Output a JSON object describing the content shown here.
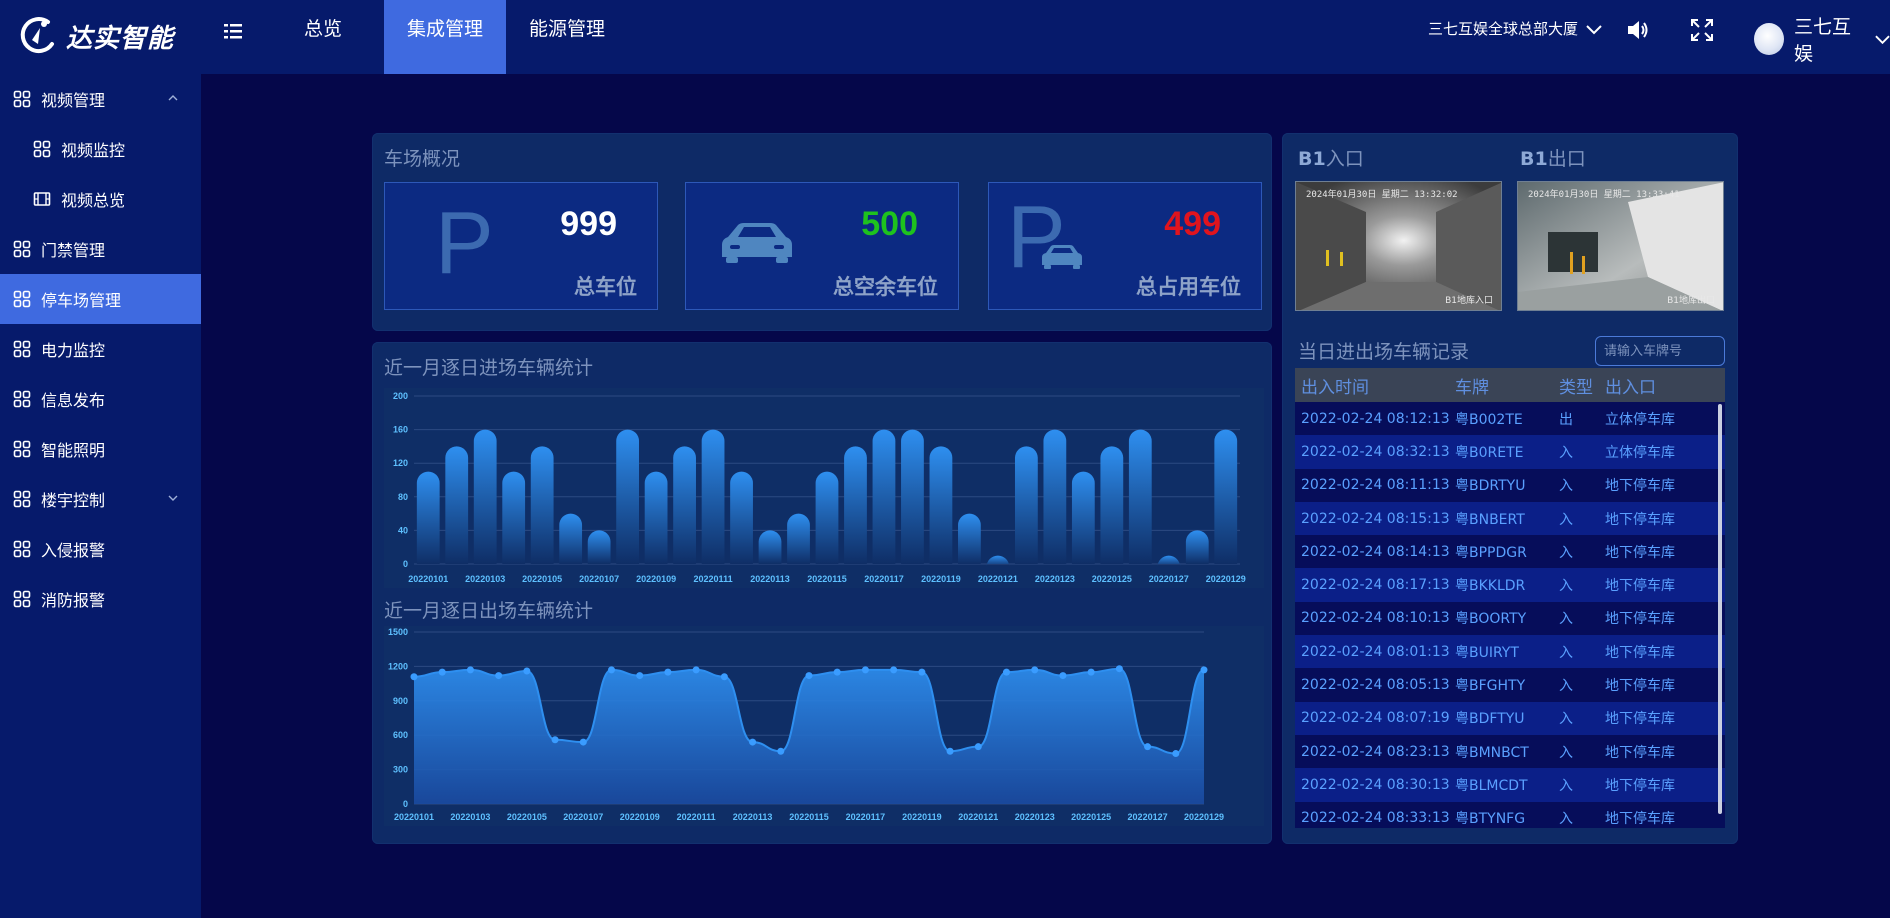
{
  "brand": {
    "name": "达实智能"
  },
  "nav": {
    "tabs": [
      {
        "label": "总览",
        "active": false
      },
      {
        "label": "集成管理",
        "active": true
      },
      {
        "label": "能源管理",
        "active": false
      }
    ],
    "location": "三七互娱全球总部大厦",
    "user": "三七互娱"
  },
  "sidebar": {
    "items": [
      {
        "label": "视频管理",
        "indent": false,
        "chevron": "up",
        "active": false
      },
      {
        "label": "视频监控",
        "indent": true,
        "chevron": "",
        "active": false
      },
      {
        "label": "视频总览",
        "indent": true,
        "chevron": "",
        "active": false
      },
      {
        "label": "门禁管理",
        "indent": false,
        "chevron": "",
        "active": false
      },
      {
        "label": "停车场管理",
        "indent": false,
        "chevron": "",
        "active": true
      },
      {
        "label": "电力监控",
        "indent": false,
        "chevron": "",
        "active": false
      },
      {
        "label": "信息发布",
        "indent": false,
        "chevron": "",
        "active": false
      },
      {
        "label": "智能照明",
        "indent": false,
        "chevron": "",
        "active": false
      },
      {
        "label": "楼宇控制",
        "indent": false,
        "chevron": "down",
        "active": false
      },
      {
        "label": "入侵报警",
        "indent": false,
        "chevron": "",
        "active": false
      },
      {
        "label": "消防报警",
        "indent": false,
        "chevron": "",
        "active": false
      }
    ]
  },
  "overview": {
    "title": "车场概况",
    "total": {
      "value": "999",
      "label": "总车位",
      "color": "#ffffff"
    },
    "free": {
      "value": "500",
      "label": "总空余车位",
      "color": "#1ec21e"
    },
    "occupied": {
      "value": "499",
      "label": "总占用车位",
      "color": "#e0141e"
    }
  },
  "cameras": {
    "entrance": {
      "title_bold": "B1",
      "title_rest": "入口",
      "stamp": "2024年01月30日 星期二 13:32:02",
      "label": "B1地库入口"
    },
    "exit": {
      "title_bold": "B1",
      "title_rest": "出口",
      "stamp": "2024年01月30日 星期二 13:33:41",
      "label": "B1地库出口"
    }
  },
  "records": {
    "title": "当日进出场车辆记录",
    "search_placeholder": "请输入车牌号",
    "headers": [
      "出入时间",
      "车牌",
      "类型",
      "出入口"
    ],
    "rows": [
      [
        "2022-02-24 08:12:13",
        "粤B002TE",
        "出",
        "立体停车库"
      ],
      [
        "2022-02-24 08:32:13",
        "粤B0RETE",
        "入",
        "立体停车库"
      ],
      [
        "2022-02-24 08:11:13",
        "粤BDRTYU",
        "入",
        "地下停车库"
      ],
      [
        "2022-02-24 08:15:13",
        "粤BNBERT",
        "入",
        "地下停车库"
      ],
      [
        "2022-02-24 08:14:13",
        "粤BPPDGR",
        "入",
        "地下停车库"
      ],
      [
        "2022-02-24 08:17:13",
        "粤BKKLDR",
        "入",
        "地下停车库"
      ],
      [
        "2022-02-24 08:10:13",
        "粤BOORTY",
        "入",
        "地下停车库"
      ],
      [
        "2022-02-24 08:01:13",
        "粤BUIRYT",
        "入",
        "地下停车库"
      ],
      [
        "2022-02-24 08:05:13",
        "粤BFGHTY",
        "入",
        "地下停车库"
      ],
      [
        "2022-02-24 08:07:19",
        "粤BDFTYU",
        "入",
        "地下停车库"
      ],
      [
        "2022-02-24 08:23:13",
        "粤BMNBCT",
        "入",
        "地下停车库"
      ],
      [
        "2022-02-24 08:30:13",
        "粤BLMCDT",
        "入",
        "地下停车库"
      ],
      [
        "2022-02-24 08:33:13",
        "粤BTYNFG",
        "入",
        "地下停车库"
      ]
    ]
  },
  "chart_data": [
    {
      "type": "bar",
      "title": "近一月逐日进场车辆统计",
      "categories": [
        "20220101",
        "20220102",
        "20220103",
        "20220104",
        "20220105",
        "20220106",
        "20220107",
        "20220108",
        "20220109",
        "20220110",
        "20220111",
        "20220112",
        "20220113",
        "20220114",
        "20220115",
        "20220116",
        "20220117",
        "20220118",
        "20220119",
        "20220120",
        "20220121",
        "20220122",
        "20220123",
        "20220124",
        "20220125",
        "20220126",
        "20220127",
        "20220128",
        "20220129"
      ],
      "tick_labels": [
        "20220101",
        "20220103",
        "20220105",
        "20220107",
        "20220109",
        "20220111",
        "20220113",
        "20220115",
        "20220117",
        "20220119",
        "20220121",
        "20220123",
        "20220125",
        "20220127",
        "20220129"
      ],
      "values": [
        110,
        140,
        160,
        110,
        140,
        60,
        40,
        160,
        110,
        140,
        160,
        110,
        40,
        60,
        110,
        140,
        160,
        160,
        140,
        60,
        10,
        140,
        160,
        110,
        140,
        160,
        10,
        40,
        160
      ],
      "ylim": [
        0,
        200
      ],
      "yticks": [
        0,
        40,
        80,
        120,
        160,
        200
      ],
      "bar_color": "#2e8ff0"
    },
    {
      "type": "area",
      "title": "近一月逐日出场车辆统计",
      "categories": [
        "20220101",
        "20220102",
        "20220103",
        "20220104",
        "20220105",
        "20220106",
        "20220107",
        "20220108",
        "20220109",
        "20220110",
        "20220111",
        "20220112",
        "20220113",
        "20220114",
        "20220115",
        "20220116",
        "20220117",
        "20220118",
        "20220119",
        "20220120",
        "20220121",
        "20220122",
        "20220123",
        "20220124",
        "20220125",
        "20220126",
        "20220127",
        "20220128",
        "20220129"
      ],
      "tick_labels": [
        "20220101",
        "20220103",
        "20220105",
        "20220107",
        "20220109",
        "20220111",
        "20220113",
        "20220115",
        "20220117",
        "20220119",
        "20220121",
        "20220123",
        "20220125",
        "20220127",
        "20220129"
      ],
      "values": [
        1110,
        1150,
        1170,
        1120,
        1160,
        560,
        540,
        1170,
        1120,
        1150,
        1170,
        1110,
        540,
        460,
        1120,
        1150,
        1170,
        1170,
        1150,
        460,
        500,
        1150,
        1170,
        1120,
        1150,
        1180,
        500,
        440,
        1170
      ],
      "ylim": [
        0,
        1500
      ],
      "yticks": [
        0,
        300,
        600,
        900,
        1200,
        1500
      ],
      "line_color": "#2e8ff0"
    }
  ]
}
